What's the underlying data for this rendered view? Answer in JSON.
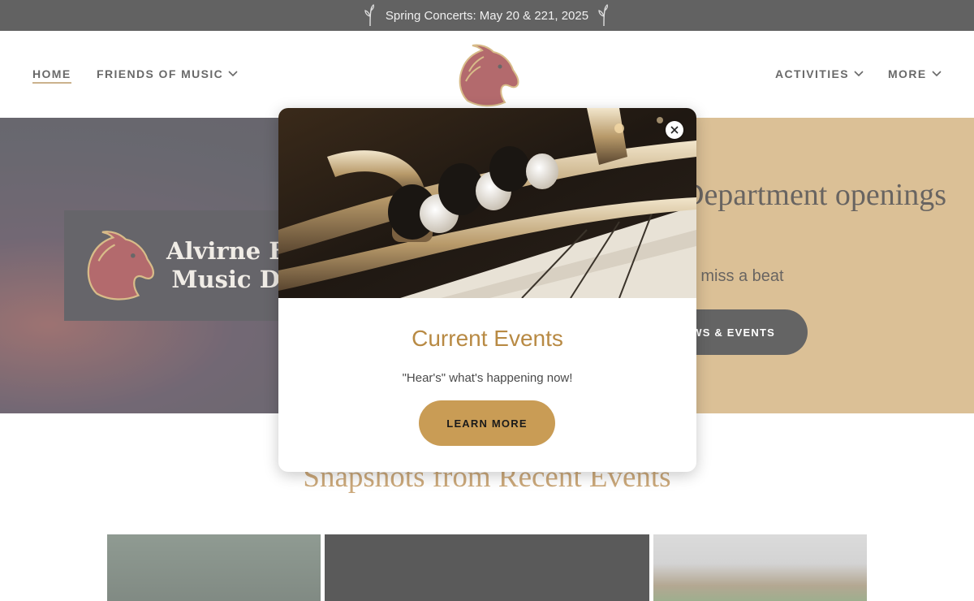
{
  "announcement": {
    "text": "Spring Concerts: May 20 & 221, 2025"
  },
  "nav": {
    "home": "HOME",
    "friends": "FRIENDS OF MUSIC",
    "activities": "ACTIVITIES",
    "more": "MORE"
  },
  "hero": {
    "banner_line1": "Alvirne Hi",
    "banner_line2": "Music De",
    "title": "Department openings",
    "subtitle": "er miss a beat",
    "button": "EWS & EVENTS"
  },
  "snapshots": {
    "title": "Snapshots from Recent Events"
  },
  "modal": {
    "title": "Current Events",
    "text": "\"Hear's\" what's happening now!",
    "button": "LEARN MORE"
  },
  "colors": {
    "accent_gold": "#c99c55",
    "title_gold": "#b88a44",
    "brand_red": "#8c1e22",
    "announcement_bg": "#111111"
  },
  "icons": [
    "sprig-icon",
    "chevron-down-icon",
    "horse-logo",
    "close-icon"
  ]
}
